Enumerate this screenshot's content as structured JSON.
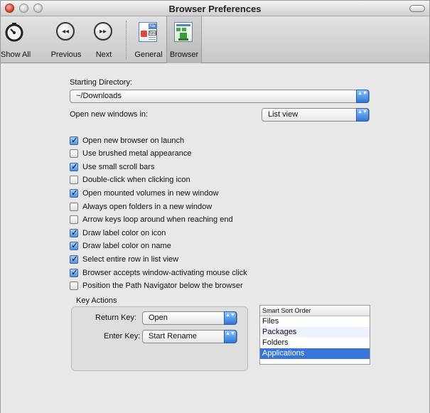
{
  "window": {
    "title": "Browser Preferences"
  },
  "toolbar": {
    "items": [
      {
        "label": "Show All",
        "icon": "show-all-icon"
      },
      {
        "label": "Previous",
        "icon": "previous-icon"
      },
      {
        "label": "Next",
        "icon": "next-icon"
      },
      {
        "label": "General",
        "icon": "general-prefs-icon",
        "icon_text_top": "File",
        "icon_text_mid": "New"
      },
      {
        "label": "Browser",
        "icon": "browser-prefs-icon"
      }
    ],
    "selected": "Browser",
    "prev_glyph": "◂◂",
    "next_glyph": "▸▸"
  },
  "starting_directory": {
    "label": "Starting Directory:",
    "value": "~/Downloads"
  },
  "open_new_windows": {
    "label": "Open new windows in:",
    "value": "List view"
  },
  "options": [
    {
      "label": "Open new browser on launch",
      "checked": true
    },
    {
      "label": "Use brushed metal appearance",
      "checked": false
    },
    {
      "label": "Use small scroll bars",
      "checked": true
    },
    {
      "label": "Double-click when clicking icon",
      "checked": false
    },
    {
      "label": "Open mounted volumes in new window",
      "checked": true
    },
    {
      "label": "Always open folders in a new window",
      "checked": false
    },
    {
      "label": "Arrow keys loop around when reaching end",
      "checked": false
    },
    {
      "label": "Draw label color on icon",
      "checked": true
    },
    {
      "label": "Draw label color on name",
      "checked": true
    },
    {
      "label": "Select entire row in list view",
      "checked": true
    },
    {
      "label": "Browser accepts window-activating mouse click",
      "checked": true
    },
    {
      "label": "Position the Path Navigator below the browser",
      "checked": false
    }
  ],
  "key_actions": {
    "title": "Key Actions",
    "return_key": {
      "label": "Return Key:",
      "value": "Open"
    },
    "enter_key": {
      "label": "Enter Key:",
      "value": "Start Rename"
    }
  },
  "smart_sort": {
    "header": "Smart Sort Order",
    "items": [
      "Files",
      "Packages",
      "Folders",
      "Applications"
    ],
    "selected": "Applications"
  },
  "popup_arrow_glyph": "▲▼",
  "colors": {
    "selection": "#3875d7",
    "accent": "#4f92e4",
    "window_bg": "#e8e8e8"
  }
}
